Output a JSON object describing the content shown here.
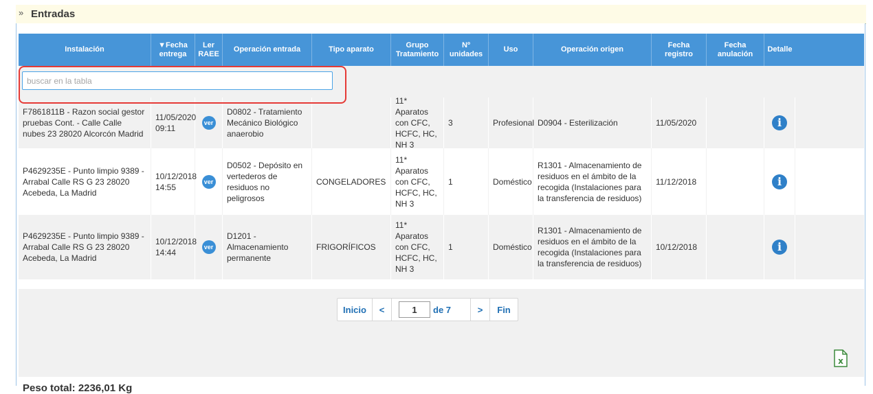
{
  "section": {
    "title": "Entradas",
    "chevron_icon": "double-chevron-right-icon"
  },
  "table": {
    "headers": [
      {
        "label": "Instalación"
      },
      {
        "label": "▼Fecha entrega"
      },
      {
        "label": "Ler RAEE"
      },
      {
        "label": "Operación entrada"
      },
      {
        "label": "Tipo aparato"
      },
      {
        "label": "Grupo Tratamiento"
      },
      {
        "label": "Nº unidades"
      },
      {
        "label": "Uso"
      },
      {
        "label": "Operación origen"
      },
      {
        "label": "Fecha registro"
      },
      {
        "label": "Fecha anulación"
      },
      {
        "label": "Detalle"
      }
    ],
    "search": {
      "placeholder": "buscar en la tabla",
      "value": ""
    },
    "rows": [
      {
        "instalacion": "F7861811B - Razon social gestor pruebas Cont. - Calle Calle nubes 23 28020 Alcorcón Madrid",
        "fecha_entrega": "11/05/2020 09:11",
        "ler": "ver",
        "operacion_entrada": "D0802 - Tratamiento Mecánico Biológico anaerobio",
        "tipo_aparato": "",
        "grupo": "11* Aparatos con CFC, HCFC, HC, NH 3",
        "unidades": "3",
        "uso": "Profesional",
        "operacion_origen": "D0904 - Esterilización",
        "fecha_registro": "11/05/2020",
        "fecha_anulacion": "",
        "detalle_icon": "info-icon"
      },
      {
        "instalacion": "P4629235E - Punto limpio 9389 - Arrabal Calle RS G 23 28020 Acebeda, La Madrid",
        "fecha_entrega": "10/12/2018 14:55",
        "ler": "ver",
        "operacion_entrada": "D0502 - Depósito en vertederos de residuos no peligrosos",
        "tipo_aparato": "CONGELADORES",
        "grupo": "11* Aparatos con CFC, HCFC, HC, NH 3",
        "unidades": "1",
        "uso": "Doméstico",
        "operacion_origen": "R1301 - Almacenamiento de residuos en el ámbito de la recogida (Instalaciones para la transferencia de residuos)",
        "fecha_registro": "11/12/2018",
        "fecha_anulacion": "",
        "detalle_icon": "info-icon"
      },
      {
        "instalacion": "P4629235E - Punto limpio 9389 - Arrabal Calle RS G 23 28020 Acebeda, La Madrid",
        "fecha_entrega": "10/12/2018 14:44",
        "ler": "ver",
        "operacion_entrada": "D1201 - Almacenamiento permanente",
        "tipo_aparato": "FRIGORÍFICOS",
        "grupo": "11* Aparatos con CFC, HCFC, HC, NH 3",
        "unidades": "1",
        "uso": "Doméstico",
        "operacion_origen": "R1301 - Almacenamiento de residuos en el ámbito de la recogida (Instalaciones para la transferencia de residuos)",
        "fecha_registro": "10/12/2018",
        "fecha_anulacion": "",
        "detalle_icon": "info-icon"
      }
    ]
  },
  "pager": {
    "first": "Inicio",
    "prev": "<",
    "current": "1",
    "of": "de 7",
    "next": ">",
    "last": "Fin"
  },
  "export": {
    "icon": "excel-export-icon"
  },
  "footer": {
    "peso_total": "Peso total: 2236,01 Kg"
  },
  "colors": {
    "header_bg": "#4795d8",
    "highlight": "#e53935",
    "badge": "#3a8fd6"
  }
}
